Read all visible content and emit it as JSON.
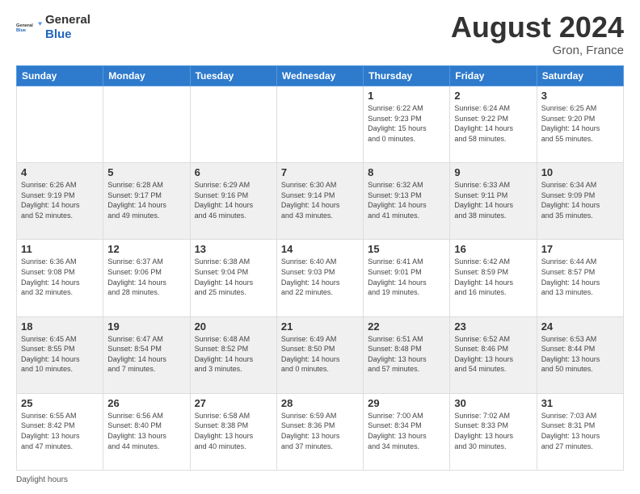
{
  "header": {
    "logo_line1": "General",
    "logo_line2": "Blue",
    "month_title": "August 2024",
    "location": "Gron, France"
  },
  "footer": {
    "label": "Daylight hours"
  },
  "weekdays": [
    "Sunday",
    "Monday",
    "Tuesday",
    "Wednesday",
    "Thursday",
    "Friday",
    "Saturday"
  ],
  "weeks": [
    [
      {
        "day": "",
        "info": ""
      },
      {
        "day": "",
        "info": ""
      },
      {
        "day": "",
        "info": ""
      },
      {
        "day": "",
        "info": ""
      },
      {
        "day": "1",
        "info": "Sunrise: 6:22 AM\nSunset: 9:23 PM\nDaylight: 15 hours\nand 0 minutes."
      },
      {
        "day": "2",
        "info": "Sunrise: 6:24 AM\nSunset: 9:22 PM\nDaylight: 14 hours\nand 58 minutes."
      },
      {
        "day": "3",
        "info": "Sunrise: 6:25 AM\nSunset: 9:20 PM\nDaylight: 14 hours\nand 55 minutes."
      }
    ],
    [
      {
        "day": "4",
        "info": "Sunrise: 6:26 AM\nSunset: 9:19 PM\nDaylight: 14 hours\nand 52 minutes."
      },
      {
        "day": "5",
        "info": "Sunrise: 6:28 AM\nSunset: 9:17 PM\nDaylight: 14 hours\nand 49 minutes."
      },
      {
        "day": "6",
        "info": "Sunrise: 6:29 AM\nSunset: 9:16 PM\nDaylight: 14 hours\nand 46 minutes."
      },
      {
        "day": "7",
        "info": "Sunrise: 6:30 AM\nSunset: 9:14 PM\nDaylight: 14 hours\nand 43 minutes."
      },
      {
        "day": "8",
        "info": "Sunrise: 6:32 AM\nSunset: 9:13 PM\nDaylight: 14 hours\nand 41 minutes."
      },
      {
        "day": "9",
        "info": "Sunrise: 6:33 AM\nSunset: 9:11 PM\nDaylight: 14 hours\nand 38 minutes."
      },
      {
        "day": "10",
        "info": "Sunrise: 6:34 AM\nSunset: 9:09 PM\nDaylight: 14 hours\nand 35 minutes."
      }
    ],
    [
      {
        "day": "11",
        "info": "Sunrise: 6:36 AM\nSunset: 9:08 PM\nDaylight: 14 hours\nand 32 minutes."
      },
      {
        "day": "12",
        "info": "Sunrise: 6:37 AM\nSunset: 9:06 PM\nDaylight: 14 hours\nand 28 minutes."
      },
      {
        "day": "13",
        "info": "Sunrise: 6:38 AM\nSunset: 9:04 PM\nDaylight: 14 hours\nand 25 minutes."
      },
      {
        "day": "14",
        "info": "Sunrise: 6:40 AM\nSunset: 9:03 PM\nDaylight: 14 hours\nand 22 minutes."
      },
      {
        "day": "15",
        "info": "Sunrise: 6:41 AM\nSunset: 9:01 PM\nDaylight: 14 hours\nand 19 minutes."
      },
      {
        "day": "16",
        "info": "Sunrise: 6:42 AM\nSunset: 8:59 PM\nDaylight: 14 hours\nand 16 minutes."
      },
      {
        "day": "17",
        "info": "Sunrise: 6:44 AM\nSunset: 8:57 PM\nDaylight: 14 hours\nand 13 minutes."
      }
    ],
    [
      {
        "day": "18",
        "info": "Sunrise: 6:45 AM\nSunset: 8:55 PM\nDaylight: 14 hours\nand 10 minutes."
      },
      {
        "day": "19",
        "info": "Sunrise: 6:47 AM\nSunset: 8:54 PM\nDaylight: 14 hours\nand 7 minutes."
      },
      {
        "day": "20",
        "info": "Sunrise: 6:48 AM\nSunset: 8:52 PM\nDaylight: 14 hours\nand 3 minutes."
      },
      {
        "day": "21",
        "info": "Sunrise: 6:49 AM\nSunset: 8:50 PM\nDaylight: 14 hours\nand 0 minutes."
      },
      {
        "day": "22",
        "info": "Sunrise: 6:51 AM\nSunset: 8:48 PM\nDaylight: 13 hours\nand 57 minutes."
      },
      {
        "day": "23",
        "info": "Sunrise: 6:52 AM\nSunset: 8:46 PM\nDaylight: 13 hours\nand 54 minutes."
      },
      {
        "day": "24",
        "info": "Sunrise: 6:53 AM\nSunset: 8:44 PM\nDaylight: 13 hours\nand 50 minutes."
      }
    ],
    [
      {
        "day": "25",
        "info": "Sunrise: 6:55 AM\nSunset: 8:42 PM\nDaylight: 13 hours\nand 47 minutes."
      },
      {
        "day": "26",
        "info": "Sunrise: 6:56 AM\nSunset: 8:40 PM\nDaylight: 13 hours\nand 44 minutes."
      },
      {
        "day": "27",
        "info": "Sunrise: 6:58 AM\nSunset: 8:38 PM\nDaylight: 13 hours\nand 40 minutes."
      },
      {
        "day": "28",
        "info": "Sunrise: 6:59 AM\nSunset: 8:36 PM\nDaylight: 13 hours\nand 37 minutes."
      },
      {
        "day": "29",
        "info": "Sunrise: 7:00 AM\nSunset: 8:34 PM\nDaylight: 13 hours\nand 34 minutes."
      },
      {
        "day": "30",
        "info": "Sunrise: 7:02 AM\nSunset: 8:33 PM\nDaylight: 13 hours\nand 30 minutes."
      },
      {
        "day": "31",
        "info": "Sunrise: 7:03 AM\nSunset: 8:31 PM\nDaylight: 13 hours\nand 27 minutes."
      }
    ]
  ]
}
